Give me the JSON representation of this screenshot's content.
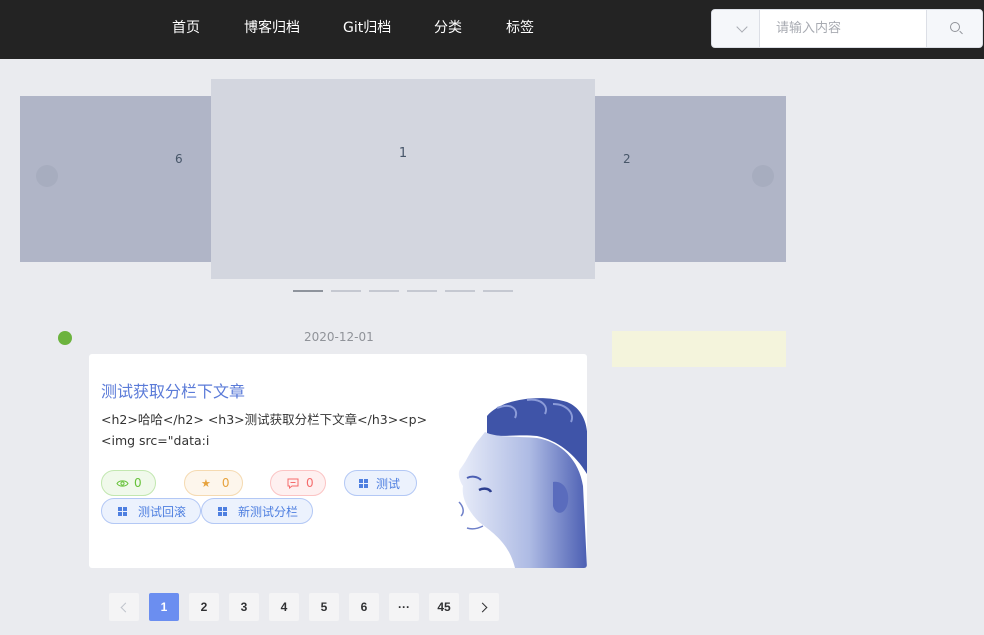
{
  "nav": {
    "items": [
      {
        "label": "首页"
      },
      {
        "label": "博客归档"
      },
      {
        "label": "Git归档"
      },
      {
        "label": "分类"
      },
      {
        "label": "标签"
      }
    ]
  },
  "search": {
    "placeholder": "请输入内容",
    "select_icon": "chevron-down-icon",
    "button_icon": "search-icon"
  },
  "carousel": {
    "prev_label": "6",
    "active_label": "1",
    "next_label": "2",
    "indicator_count": 6,
    "active_index": 0
  },
  "post": {
    "date": "2020-12-01",
    "title": "测试获取分栏下文章",
    "excerpt": "<h2>哈哈</h2> <h3>测试获取分栏下文章</h3><p><img src=\"data:i",
    "views": "0",
    "stars": "0",
    "comments": "0",
    "tags": [
      "测试",
      "测试回滚",
      "新测试分栏"
    ],
    "colors": {
      "title": "#5b7bd8",
      "views": "#67c23a",
      "stars": "#e6a23c",
      "comments": "#f56c6c",
      "tag": "#4e7fe0",
      "timeline_dot": "#6cb33e"
    }
  },
  "pagination": {
    "pages": [
      "1",
      "2",
      "3",
      "4",
      "5",
      "6"
    ],
    "ellipsis": "···",
    "last": "45",
    "current": "1",
    "accent": "#6b8ef0"
  }
}
